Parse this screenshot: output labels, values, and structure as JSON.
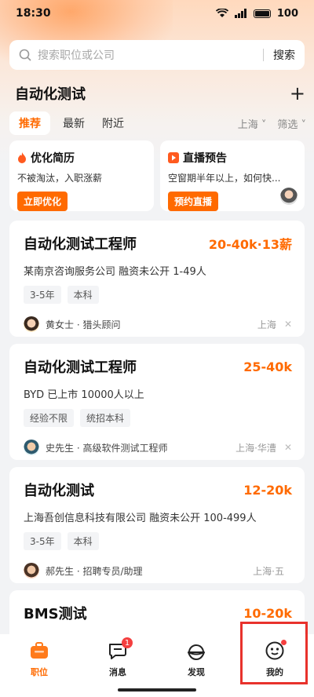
{
  "status_bar": {
    "time": "18:30",
    "battery": "100"
  },
  "search": {
    "placeholder": "搜索职位或公司",
    "button": "搜索"
  },
  "header": {
    "title": "自动化测试"
  },
  "tabs": [
    "推荐",
    "最新",
    "附近"
  ],
  "filters": {
    "city": "上海",
    "filter": "筛选"
  },
  "promos": [
    {
      "title": "优化简历",
      "desc": "不被淘汰，入职涨薪",
      "button": "立即优化"
    },
    {
      "title": "直播预告",
      "desc": "空窗期半年以上，如何快...",
      "button": "预约直播"
    }
  ],
  "jobs": [
    {
      "title": "自动化测试工程师",
      "salary": "20-40k·13薪",
      "company": "某南京咨询服务公司  融资未公开  1-49人",
      "tags": [
        "3-5年",
        "本科"
      ],
      "recruiter": "黄女士 · 猎头顾问",
      "location": "上海"
    },
    {
      "title": "自动化测试工程师",
      "salary": "25-40k",
      "company": "BYD  已上市  10000人以上",
      "tags": [
        "经验不限",
        "统招本科"
      ],
      "recruiter": "史先生 · 高级软件测试工程师",
      "location": "上海·华漕"
    },
    {
      "title": "自动化测试",
      "salary": "12-20k",
      "company": "上海吾创信息科技有限公司  融资未公开  100-499人",
      "tags": [
        "3-5年",
        "本科"
      ],
      "recruiter": "郝先生 · 招聘专员/助理",
      "location": "上海·五"
    },
    {
      "title": "BMS测试",
      "salary": "10-20k"
    }
  ],
  "nav": {
    "items": [
      {
        "label": "职位"
      },
      {
        "label": "消息",
        "badge": "1"
      },
      {
        "label": "发现"
      },
      {
        "label": "我的"
      }
    ]
  },
  "colors": {
    "accent": "#ff6a00",
    "badge": "#f43f3f",
    "highlight": "#e8322c"
  }
}
